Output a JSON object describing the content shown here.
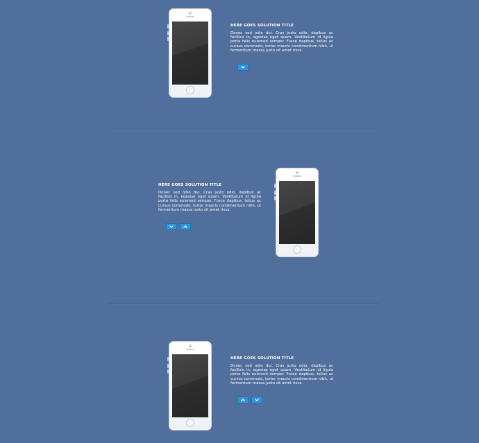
{
  "sections": [
    {
      "title": "HERE GOES SOLUTION TITLE",
      "description": "Donec sed odio dui. Cras justo odio, dapibus ac facilisis in, egestas eget quam. Vestibulum id ligula porta felis euismod semper. Fusce dapibus, tellus ac cursus commodo, tortor mauris condimentum nibh, ut fermentum massa justo sit amet risus.",
      "buttons": [
        "chevron-down"
      ]
    },
    {
      "title": "HERE GOES SOLUTION TITLE",
      "description": "Donec sed odio dui. Cras justo odio, dapibus ac facilisis in, egestas eget quam. Vestibulum id ligula porta felis euismod semper. Fusce dapibus, tellus ac cursus commodo, tortor mauris condimentum nibh, ut fermentum massa justo sit amet risus.",
      "buttons": [
        "chevron-down",
        "chevron-up"
      ]
    },
    {
      "title": "HERE GOES SOLUTION TITLE",
      "description": "Donec sed odio dui. Cras justo odio, dapibus ac facilisis in, egestas eget quam. Vestibulum id ligula porta felis euismod semper. Fusce dapibus, tellus ac cursus commodo, tortor mauris condimentum nibh, ut fermentum massa justo sit amet risus.",
      "buttons": [
        "chevron-up",
        "chevron-down"
      ]
    }
  ],
  "colors": {
    "background": "#516f9c",
    "button": "#2e95de",
    "text": "#ffffff"
  }
}
